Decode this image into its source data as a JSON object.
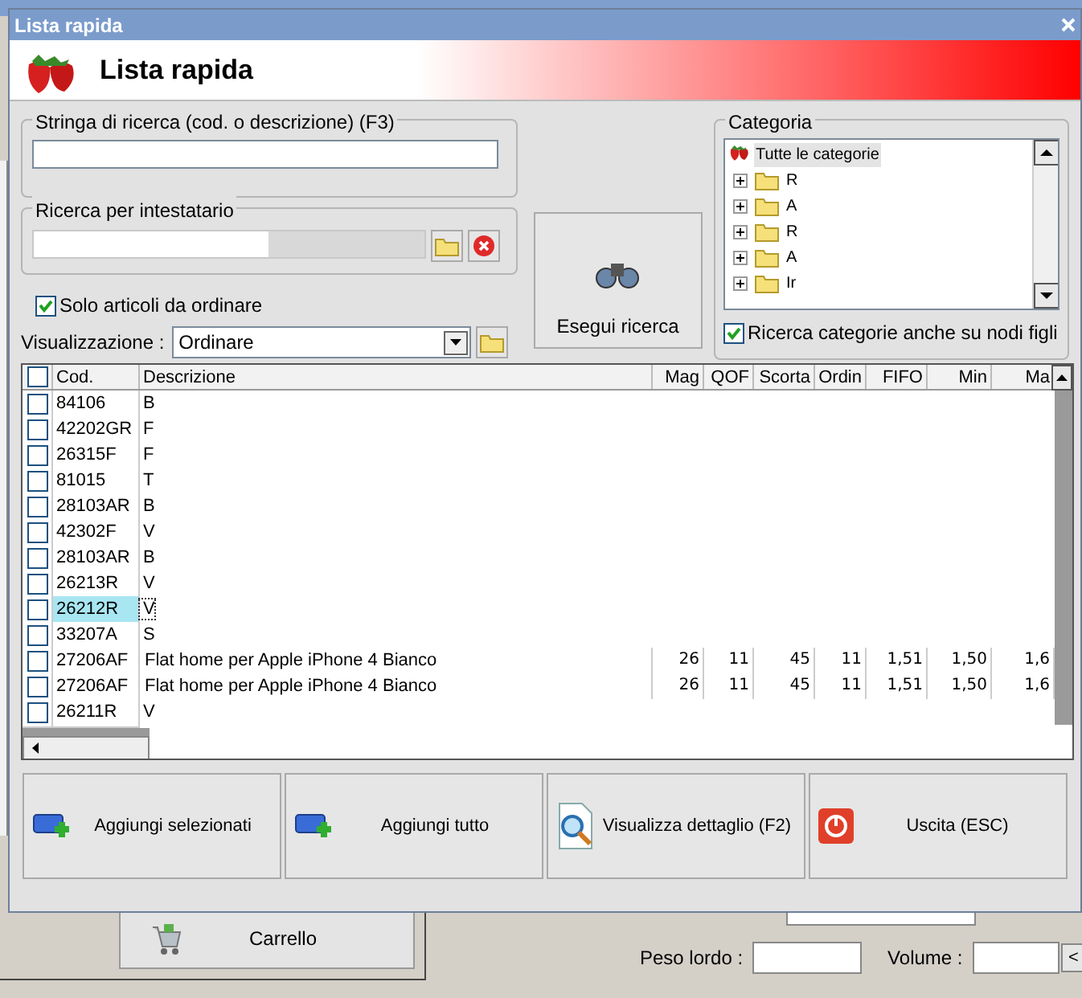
{
  "window": {
    "title": "Lista rapida"
  },
  "header": {
    "title": "Lista rapida"
  },
  "search": {
    "label": "Stringa di ricerca (cod. o descrizione) (F3)"
  },
  "owner_search": {
    "label": "Ricerca per intestatario"
  },
  "only_to_order": {
    "label": "Solo articoli da ordinare",
    "checked": true
  },
  "view": {
    "label": "Visualizzazione :",
    "value": "Ordinare"
  },
  "search_button": {
    "label": "Esegui ricerca"
  },
  "category": {
    "label": "Categoria",
    "tree": [
      {
        "label": "Tutte le categorie",
        "selected": true,
        "children": [
          {
            "label": "R",
            "selected": false
          },
          {
            "label": "A",
            "selected": false
          },
          {
            "label": "R",
            "selected": false
          },
          {
            "label": "A",
            "selected": false
          },
          {
            "label": "Ir",
            "selected": false
          }
        ]
      }
    ],
    "include_children": {
      "label": "Ricerca categorie anche su nodi figli",
      "checked": true
    }
  },
  "table": {
    "header_checked": false,
    "columns": [
      "Cod.",
      "Descrizione",
      "Mag",
      "QOF",
      "Scorta",
      "Ordin",
      "FIFO",
      "Min",
      "Ma"
    ],
    "rows": [
      {
        "checked": false,
        "selected": false,
        "code": "84106",
        "description": "B"
      },
      {
        "checked": false,
        "selected": false,
        "code": "42202GR",
        "description": "F"
      },
      {
        "checked": false,
        "selected": false,
        "code": "26315F",
        "description": "F"
      },
      {
        "checked": false,
        "selected": false,
        "code": "81015",
        "description": "T"
      },
      {
        "checked": false,
        "selected": false,
        "code": "28103AR",
        "description": "B"
      },
      {
        "checked": false,
        "selected": false,
        "code": "42302F",
        "description": "V"
      },
      {
        "checked": false,
        "selected": false,
        "code": "28103AR",
        "description": "B"
      },
      {
        "checked": false,
        "selected": false,
        "code": "26213R",
        "description": "V"
      },
      {
        "checked": false,
        "selected": true,
        "code": "26212R",
        "description": "V"
      },
      {
        "checked": false,
        "selected": false,
        "code": "33207A",
        "description": "S"
      },
      {
        "checked": false,
        "selected": false,
        "code": "27206AF",
        "description": "Flat home per Apple iPhone 4 Bianco",
        "values": [
          "26",
          "11",
          "45",
          "11",
          "1,51",
          "1,50",
          "1,6"
        ]
      },
      {
        "checked": false,
        "selected": false,
        "code": "27206AF",
        "description": "Flat home per Apple iPhone 4 Bianco",
        "values": [
          "26",
          "11",
          "45",
          "11",
          "1,51",
          "1,50",
          "1,6"
        ]
      },
      {
        "checked": false,
        "selected": false,
        "code": "26211R",
        "description": "V"
      }
    ]
  },
  "buttons": [
    {
      "label": "Aggiungi selezionati",
      "kind": "add"
    },
    {
      "label": "Aggiungi tutto",
      "kind": "add"
    },
    {
      "label": "Visualizza dettaglio (F2)",
      "kind": "detail"
    },
    {
      "label": "Uscita (ESC)",
      "kind": "exit"
    }
  ],
  "background": {
    "cart_button": "Carrello",
    "weight_label": "Peso lordo :",
    "volume_label": "Volume :",
    "expand_button": "<"
  }
}
